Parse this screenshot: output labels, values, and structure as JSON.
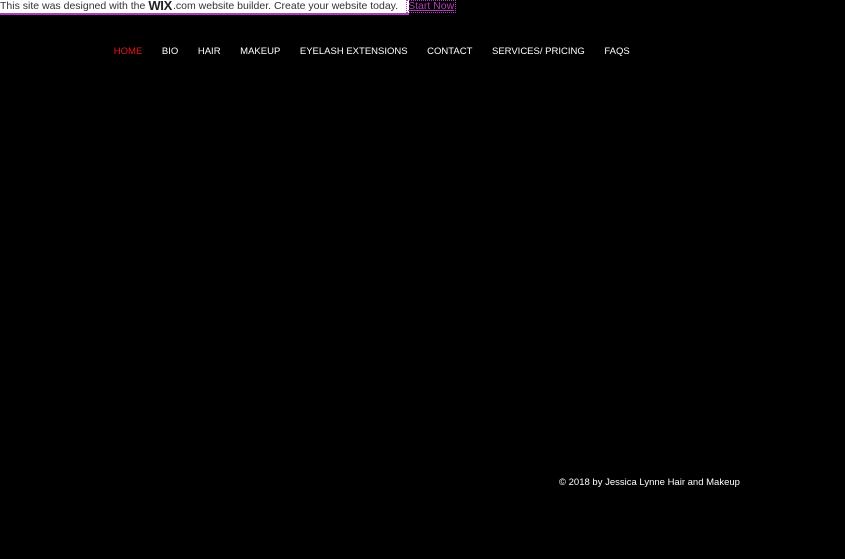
{
  "banner": {
    "prefix": "This site was designed with the",
    "logo": "WIX",
    "logo_suffix": ".com website builder. Create your website today.",
    "cta": "Start Now",
    "accent_color": "#b23bbd"
  },
  "nav": {
    "active_color": "#e8141e",
    "items": [
      {
        "label": "HOME"
      },
      {
        "label": "BIO"
      },
      {
        "label": "HAIR"
      },
      {
        "label": "MAKEUP"
      },
      {
        "label": "EYELASH EXTENSIONS"
      },
      {
        "label": "CONTACT"
      },
      {
        "label": "SERVICES/ PRICING"
      },
      {
        "label": "FAQS"
      }
    ]
  },
  "footer": {
    "copyright": "© 2018 by Jessica Lynne Hair and Makeup"
  }
}
